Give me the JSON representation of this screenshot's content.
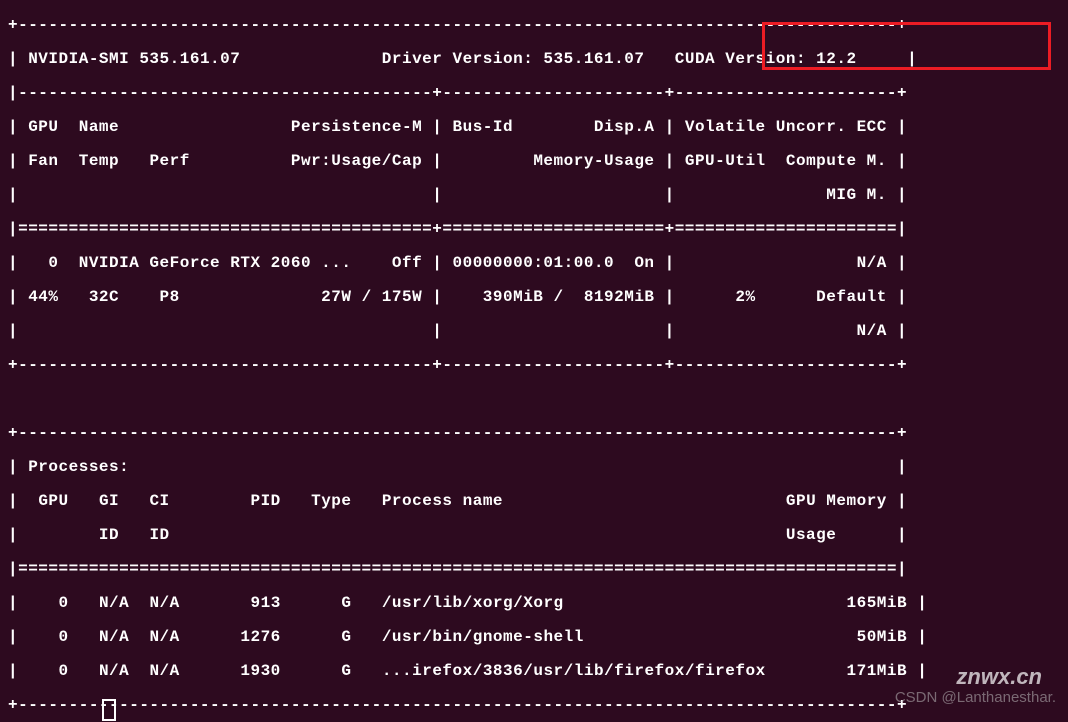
{
  "header": {
    "smi_label": "NVIDIA-SMI",
    "smi_version": "535.161.07",
    "driver_label": "Driver Version:",
    "driver_version": "535.161.07",
    "cuda_label": "CUDA Version:",
    "cuda_version": "12.2"
  },
  "columns": {
    "r1c1a": "GPU",
    "r1c1b": "Name",
    "r1c1c": "Persistence-M",
    "r1c2a": "Bus-Id",
    "r1c2b": "Disp.A",
    "r1c3": "Volatile Uncorr. ECC",
    "r2c1a": "Fan",
    "r2c1b": "Temp",
    "r2c1c": "Perf",
    "r2c1d": "Pwr:Usage/Cap",
    "r2c2": "Memory-Usage",
    "r2c3a": "GPU-Util",
    "r2c3b": "Compute M.",
    "r3c3": "MIG M."
  },
  "gpu": {
    "id": "0",
    "name": "NVIDIA GeForce RTX 2060 ...",
    "persist": "Off",
    "busid": "00000000:01:00.0",
    "disp": "On",
    "ecc": "N/A",
    "fan": "44%",
    "temp": "32C",
    "perf": "P8",
    "pwr": "27W / 175W",
    "mem": "390MiB /  8192MiB",
    "util": "2%",
    "compute": "Default",
    "mig": "N/A"
  },
  "proc": {
    "title": "Processes:",
    "h_gpu": "GPU",
    "h_gi": "GI",
    "h_ci": "CI",
    "h_pid": "PID",
    "h_type": "Type",
    "h_name": "Process name",
    "h_mem": "GPU Memory",
    "h_id": "ID",
    "h_usage": "Usage",
    "rows": [
      {
        "gpu": "0",
        "gi": "N/A",
        "ci": "N/A",
        "pid": "913",
        "type": "G",
        "name": "/usr/lib/xorg/Xorg",
        "mem": "165MiB"
      },
      {
        "gpu": "0",
        "gi": "N/A",
        "ci": "N/A",
        "pid": "1276",
        "type": "G",
        "name": "/usr/bin/gnome-shell",
        "mem": "50MiB"
      },
      {
        "gpu": "0",
        "gi": "N/A",
        "ci": "N/A",
        "pid": "1930",
        "type": "G",
        "name": "...irefox/3836/usr/lib/firefox/firefox",
        "mem": "171MiB"
      }
    ]
  },
  "watermark1": "CSDN @Lanthanesthar.",
  "watermark2": "znwx.cn"
}
